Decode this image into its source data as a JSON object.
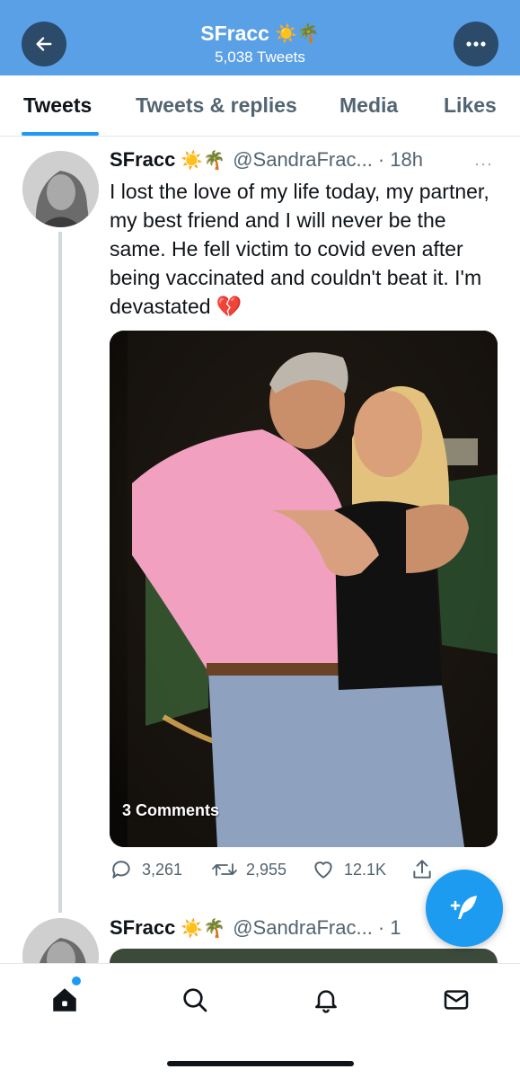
{
  "header": {
    "title": "SFracc",
    "title_emoji": "☀️🌴",
    "subtitle": "5,038 Tweets",
    "colors": {
      "bar": "#5aa0e6",
      "button": "#2c4a6a"
    }
  },
  "tabs": [
    {
      "label": "Tweets",
      "active": true
    },
    {
      "label": "Tweets & replies",
      "active": false
    },
    {
      "label": "Media",
      "active": false
    },
    {
      "label": "Likes",
      "active": false
    }
  ],
  "tweet": {
    "name": "SFracc",
    "emoji": "☀️🌴",
    "handle": "@SandraFrac...",
    "time": "· 18h",
    "more": "···",
    "text": "I lost the love of my life today, my partner, my best friend and I will never be the same. He fell victim to covid even after being vaccinated and couldn't beat it. I'm devastated 💔",
    "media_caption": "3 Comments",
    "actions": {
      "replies": "3,261",
      "retweets": "2,955",
      "likes": "12.1K"
    }
  },
  "next_tweet": {
    "name": "SFracc",
    "emoji": "☀️🌴",
    "handle": "@SandraFrac...",
    "time": "· 1"
  },
  "bottom_nav": [
    {
      "icon": "home-icon",
      "active": true
    },
    {
      "icon": "search-icon",
      "active": false
    },
    {
      "icon": "notifications-icon",
      "active": false
    },
    {
      "icon": "messages-icon",
      "active": false
    }
  ],
  "accent": "#1d9bf0"
}
